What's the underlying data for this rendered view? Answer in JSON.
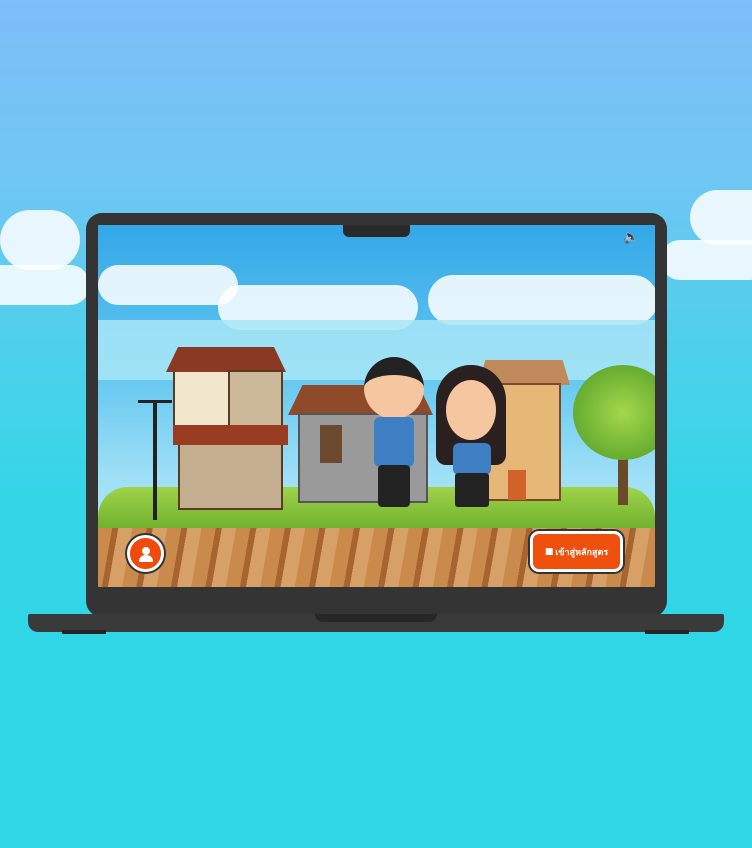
{
  "toolbar": {
    "sound_icon": "speaker-icon",
    "profile_icon": "user-icon"
  },
  "actions": {
    "enter_course_label": "เข้าสู่หลักสูตร",
    "enter_course_icon": "book-icon"
  },
  "colors": {
    "accent": "#f0500e",
    "bezel": "#343434",
    "background": "#30d5e6"
  }
}
